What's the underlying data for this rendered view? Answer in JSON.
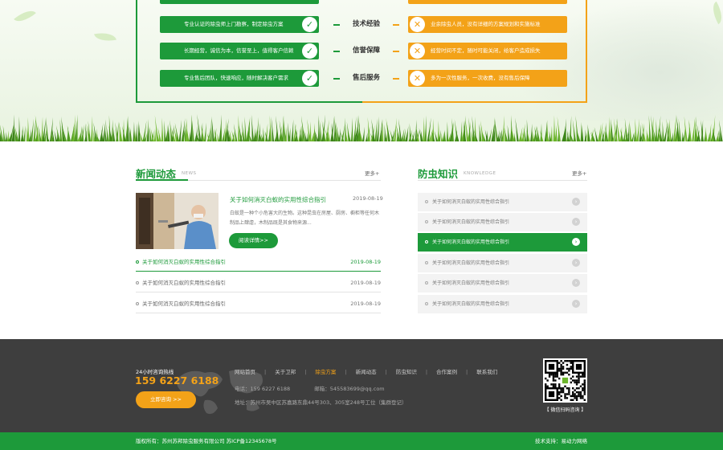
{
  "compare": {
    "rows": [
      {
        "good": "专业认证的除虫师上门勘察，制定除虫方案",
        "label": "技术经验",
        "bad": "业余除虫人员，没有详细的方案规划和实施标准"
      },
      {
        "good": "长期经营，诚信为本，信誉至上，值得客户信赖",
        "label": "信誉保障",
        "bad": "经营时间不定，随时可能关闭，给客户造成损失"
      },
      {
        "good": "专业售后团队，快速响应，随时解决客户需求",
        "label": "售后服务",
        "bad": "多为一次性服务，一次收费，没有售后保障"
      }
    ]
  },
  "news": {
    "title": "新闻动态",
    "title_en": "NEWS",
    "more": "更多+",
    "featured": {
      "title": "关于如何消灭白蚁的实用性综合指引",
      "date": "2019-08-19",
      "desc": "白蚁是一种个小危害大的生物。这种昆虫在房屋、厨房、橱柜等任何木制品上肆虐，木制品既是其食物来源...",
      "button": "阅读详情>>"
    },
    "items": [
      {
        "title": "关于如何消灭白蚁的实用性综合指引",
        "date": "2019-08-19"
      },
      {
        "title": "关于如何消灭白蚁的实用性综合指引",
        "date": "2019-08-19"
      },
      {
        "title": "关于如何消灭白蚁的实用性综合指引",
        "date": "2019-08-19"
      }
    ]
  },
  "knowledge": {
    "title": "防虫知识",
    "title_en": "KNOWLEDGE",
    "more": "更多+",
    "items": [
      {
        "title": "关于如何消灭白蚁的实用性综合指引"
      },
      {
        "title": "关于如何消灭白蚁的实用性综合指引"
      },
      {
        "title": "关于如何消灭白蚁的实用性综合指引"
      },
      {
        "title": "关于如何消灭白蚁的实用性综合指引"
      },
      {
        "title": "关于如何消灭白蚁的实用性综合指引"
      },
      {
        "title": "关于如何消灭白蚁的实用性综合指引"
      }
    ],
    "active_index": 2
  },
  "footer": {
    "hotline_label": "24小时咨询热线",
    "hotline": "159 6227 6188",
    "consult_button": "立即咨询 >>",
    "nav": [
      "网站首页",
      "关于卫邦",
      "除虫方案",
      "新闻动态",
      "防虫知识",
      "合作案例",
      "联系我们"
    ],
    "nav_active_index": 2,
    "phone": "电话：159 6227 6188",
    "email": "邮箱：545583699@qq.com",
    "address": "地址：苏州市吴中区苏嘉路东鼎44号303、305室248号工位（集群登记）",
    "qr_caption": "【 微信扫码咨询 】",
    "copyright": "版权所有：苏州苏邦除虫服务有限公司 苏ICP备12345678号",
    "support": "技术支持：易动力网络"
  },
  "colors": {
    "green": "#1d9a3a",
    "orange": "#f3a218",
    "footer_bg": "#3e3e3e"
  }
}
